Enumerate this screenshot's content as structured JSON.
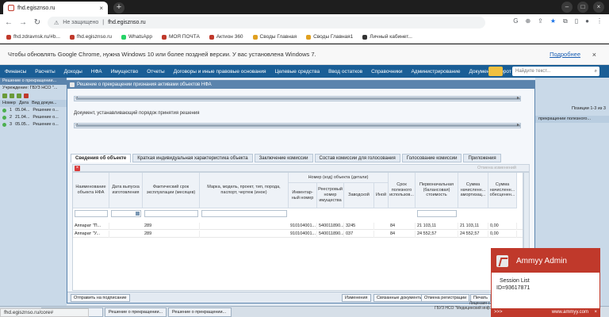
{
  "browser": {
    "tab_title": "fhd.egisznso.ru",
    "tab_close": "×",
    "new_tab": "+",
    "url_security": "Не защищено",
    "url_sep": "|",
    "url_host": "fhd.egisznso.ru",
    "bookmarks": [
      "fhd.zdravnsk.ru/#b...",
      "fhd.egisznso.ru",
      "WhatsApp",
      "МОЯ ПОЧТА",
      "Актион 360",
      "Своды Главная",
      "Своды Главная1",
      "Личный кабинет..."
    ],
    "info_text": "Чтобы обновлять Google Chrome, нужна Windows 10 или более поздней версии. У вас установлена Windows 7.",
    "info_link": "Подробнее",
    "info_close": "×"
  },
  "menu": {
    "items": [
      "Финансы",
      "Расчеты",
      "Доходы",
      "НФА",
      "Имущество",
      "Отчеты",
      "Договоры и иные правовые основания",
      "Целевые средства",
      "Ввод остатков",
      "Справочники",
      "Администрирование",
      "Документооборот"
    ],
    "search_placeholder": "Найдите текст..."
  },
  "left": {
    "title": "Решение о прекращении...",
    "org_label": "Учреждение:",
    "org_value": "ГБУЗ НСО \"...",
    "cols": [
      "Номер",
      "Дата",
      "Вид докум..."
    ],
    "rows": [
      {
        "no": "1",
        "date": "05.04...",
        "doc": "Решение о..."
      },
      {
        "no": "2",
        "date": "21.04...",
        "doc": "Решение о..."
      },
      {
        "no": "3",
        "date": "05.05...",
        "doc": "Решение о..."
      }
    ]
  },
  "right": {
    "pager": "Позиции 1-3 из 3",
    "col": "прекращении полезного..."
  },
  "dialog": {
    "title": "Решение о прекращении признания активами объектов НФА",
    "doc_label": "Документ, устанавливающий порядок принятия решения",
    "tabs": [
      "Сведения об объекте",
      "Краткая индивидуальная характеристика объекта",
      "Заключение комиссии",
      "Состав комиссии для голосования",
      "Голосование комиссии",
      "Приложения"
    ],
    "grid_toolbar_right": "Отмена изменений",
    "group_header": "Номер (код) объекта (детали)",
    "headers": [
      "Наименование объекта НФА",
      "Дата выпуска изготовления",
      "Фактический срок эксплуатации (месяцев)",
      "Марка, модель, проект, тип, порода, паспорт, чертеж (иное)",
      "Инвентар-ный номер",
      "Реестровый номер имущества",
      "Заводской",
      "Иной",
      "Срок полезного использов...",
      "Первоначальная (балансовая) стоимость",
      "Сумма начисленн... амортизац...",
      "Сумма начисленн... обесценен..."
    ],
    "rows": [
      [
        "Аппарат \"П...",
        "",
        "289",
        "",
        "910104001...",
        "540011890...",
        "3245",
        "",
        "84",
        "21 103,11",
        "21 103,11",
        "0,00"
      ],
      [
        "Аппарат \"У...",
        "",
        "289",
        "",
        "910104001...",
        "540011890...",
        "037",
        "",
        "84",
        "24 552,57",
        "24 552,57",
        "0,00"
      ]
    ],
    "footer_left": "Отправить на подписание",
    "footer_buttons": [
      "Изменения",
      "Связанные документы",
      "Отмена регистрации",
      "Печать"
    ]
  },
  "taskbar": {
    "items": [
      "...писании объект...",
      "Решение о прекращении...",
      "Решение о прекращении..."
    ],
    "status_url": "fhd.egisznso.ru/core#",
    "corp_line1": "Лицензия с...",
    "corp_line2": "ГБУЗ НСО \"Медицинский инф..."
  },
  "ammyy": {
    "title": "Ammyy Admin",
    "session": "Session List",
    "id": "ID=93617871",
    "footer_left": ">>>",
    "footer_site": "www.ammyy.com",
    "footer_close": "×"
  },
  "colors": {
    "menubar": "#1a5e96",
    "dialog_header": "#5b84ad",
    "ammyy_red": "#c0392b"
  }
}
